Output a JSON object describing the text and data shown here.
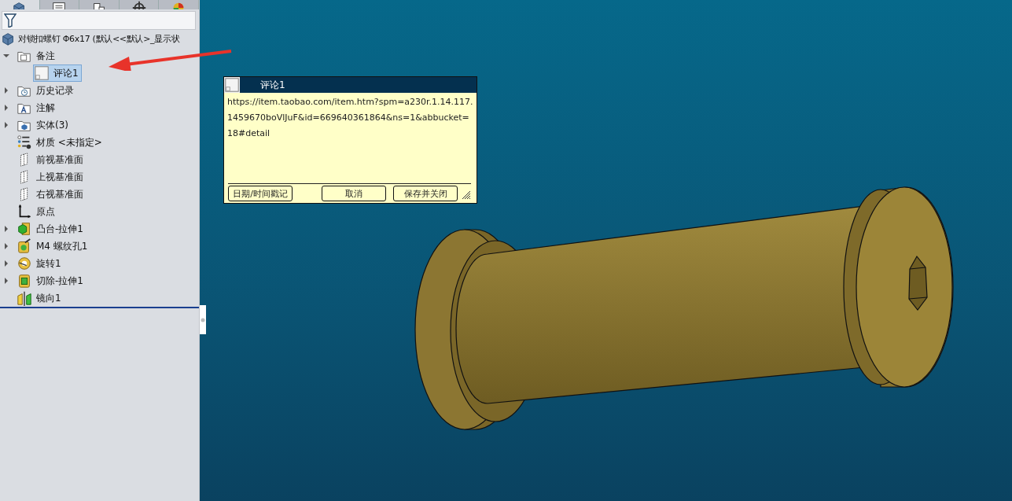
{
  "tabs": [
    {
      "kind": "part",
      "selected": true
    },
    {
      "kind": "property",
      "selected": false
    },
    {
      "kind": "config",
      "selected": false
    },
    {
      "kind": "target",
      "selected": false
    },
    {
      "kind": "appearance",
      "selected": false
    }
  ],
  "tree": {
    "root": "对锁扣螺钉 Φ6x17  (默认<<默认>_显示状",
    "items": [
      {
        "kind": "folder",
        "label": "备注",
        "expanded": true,
        "children": [
          {
            "kind": "note",
            "label": "评论1",
            "selected": true
          }
        ]
      },
      {
        "kind": "history",
        "label": "历史记录",
        "expanded": false
      },
      {
        "kind": "annotation",
        "label": "注解",
        "expanded": false
      },
      {
        "kind": "solid",
        "label": "实体(3)",
        "expanded": false
      },
      {
        "kind": "material",
        "label": "材质 <未指定>"
      },
      {
        "kind": "plane",
        "label": "前视基准面"
      },
      {
        "kind": "plane",
        "label": "上视基准面"
      },
      {
        "kind": "plane",
        "label": "右视基准面"
      },
      {
        "kind": "origin",
        "label": "原点"
      },
      {
        "kind": "extrude",
        "label": "凸台-拉伸1",
        "expanded": false
      },
      {
        "kind": "hole",
        "label": "M4 螺纹孔1",
        "expanded": false
      },
      {
        "kind": "revolve",
        "label": "旋转1",
        "expanded": false
      },
      {
        "kind": "cut",
        "label": "切除-拉伸1",
        "expanded": false
      },
      {
        "kind": "mirror",
        "label": "镜向1"
      }
    ]
  },
  "comment": {
    "title": "评论1",
    "text": "https://item.taobao.com/item.htm?spm=a230r.1.14.117.1459670boVlJuF&id=669640361864&ns=1&abbucket=18#detail",
    "buttons": [
      "日期/时间戳记",
      "取消",
      "保存并关闭"
    ]
  }
}
